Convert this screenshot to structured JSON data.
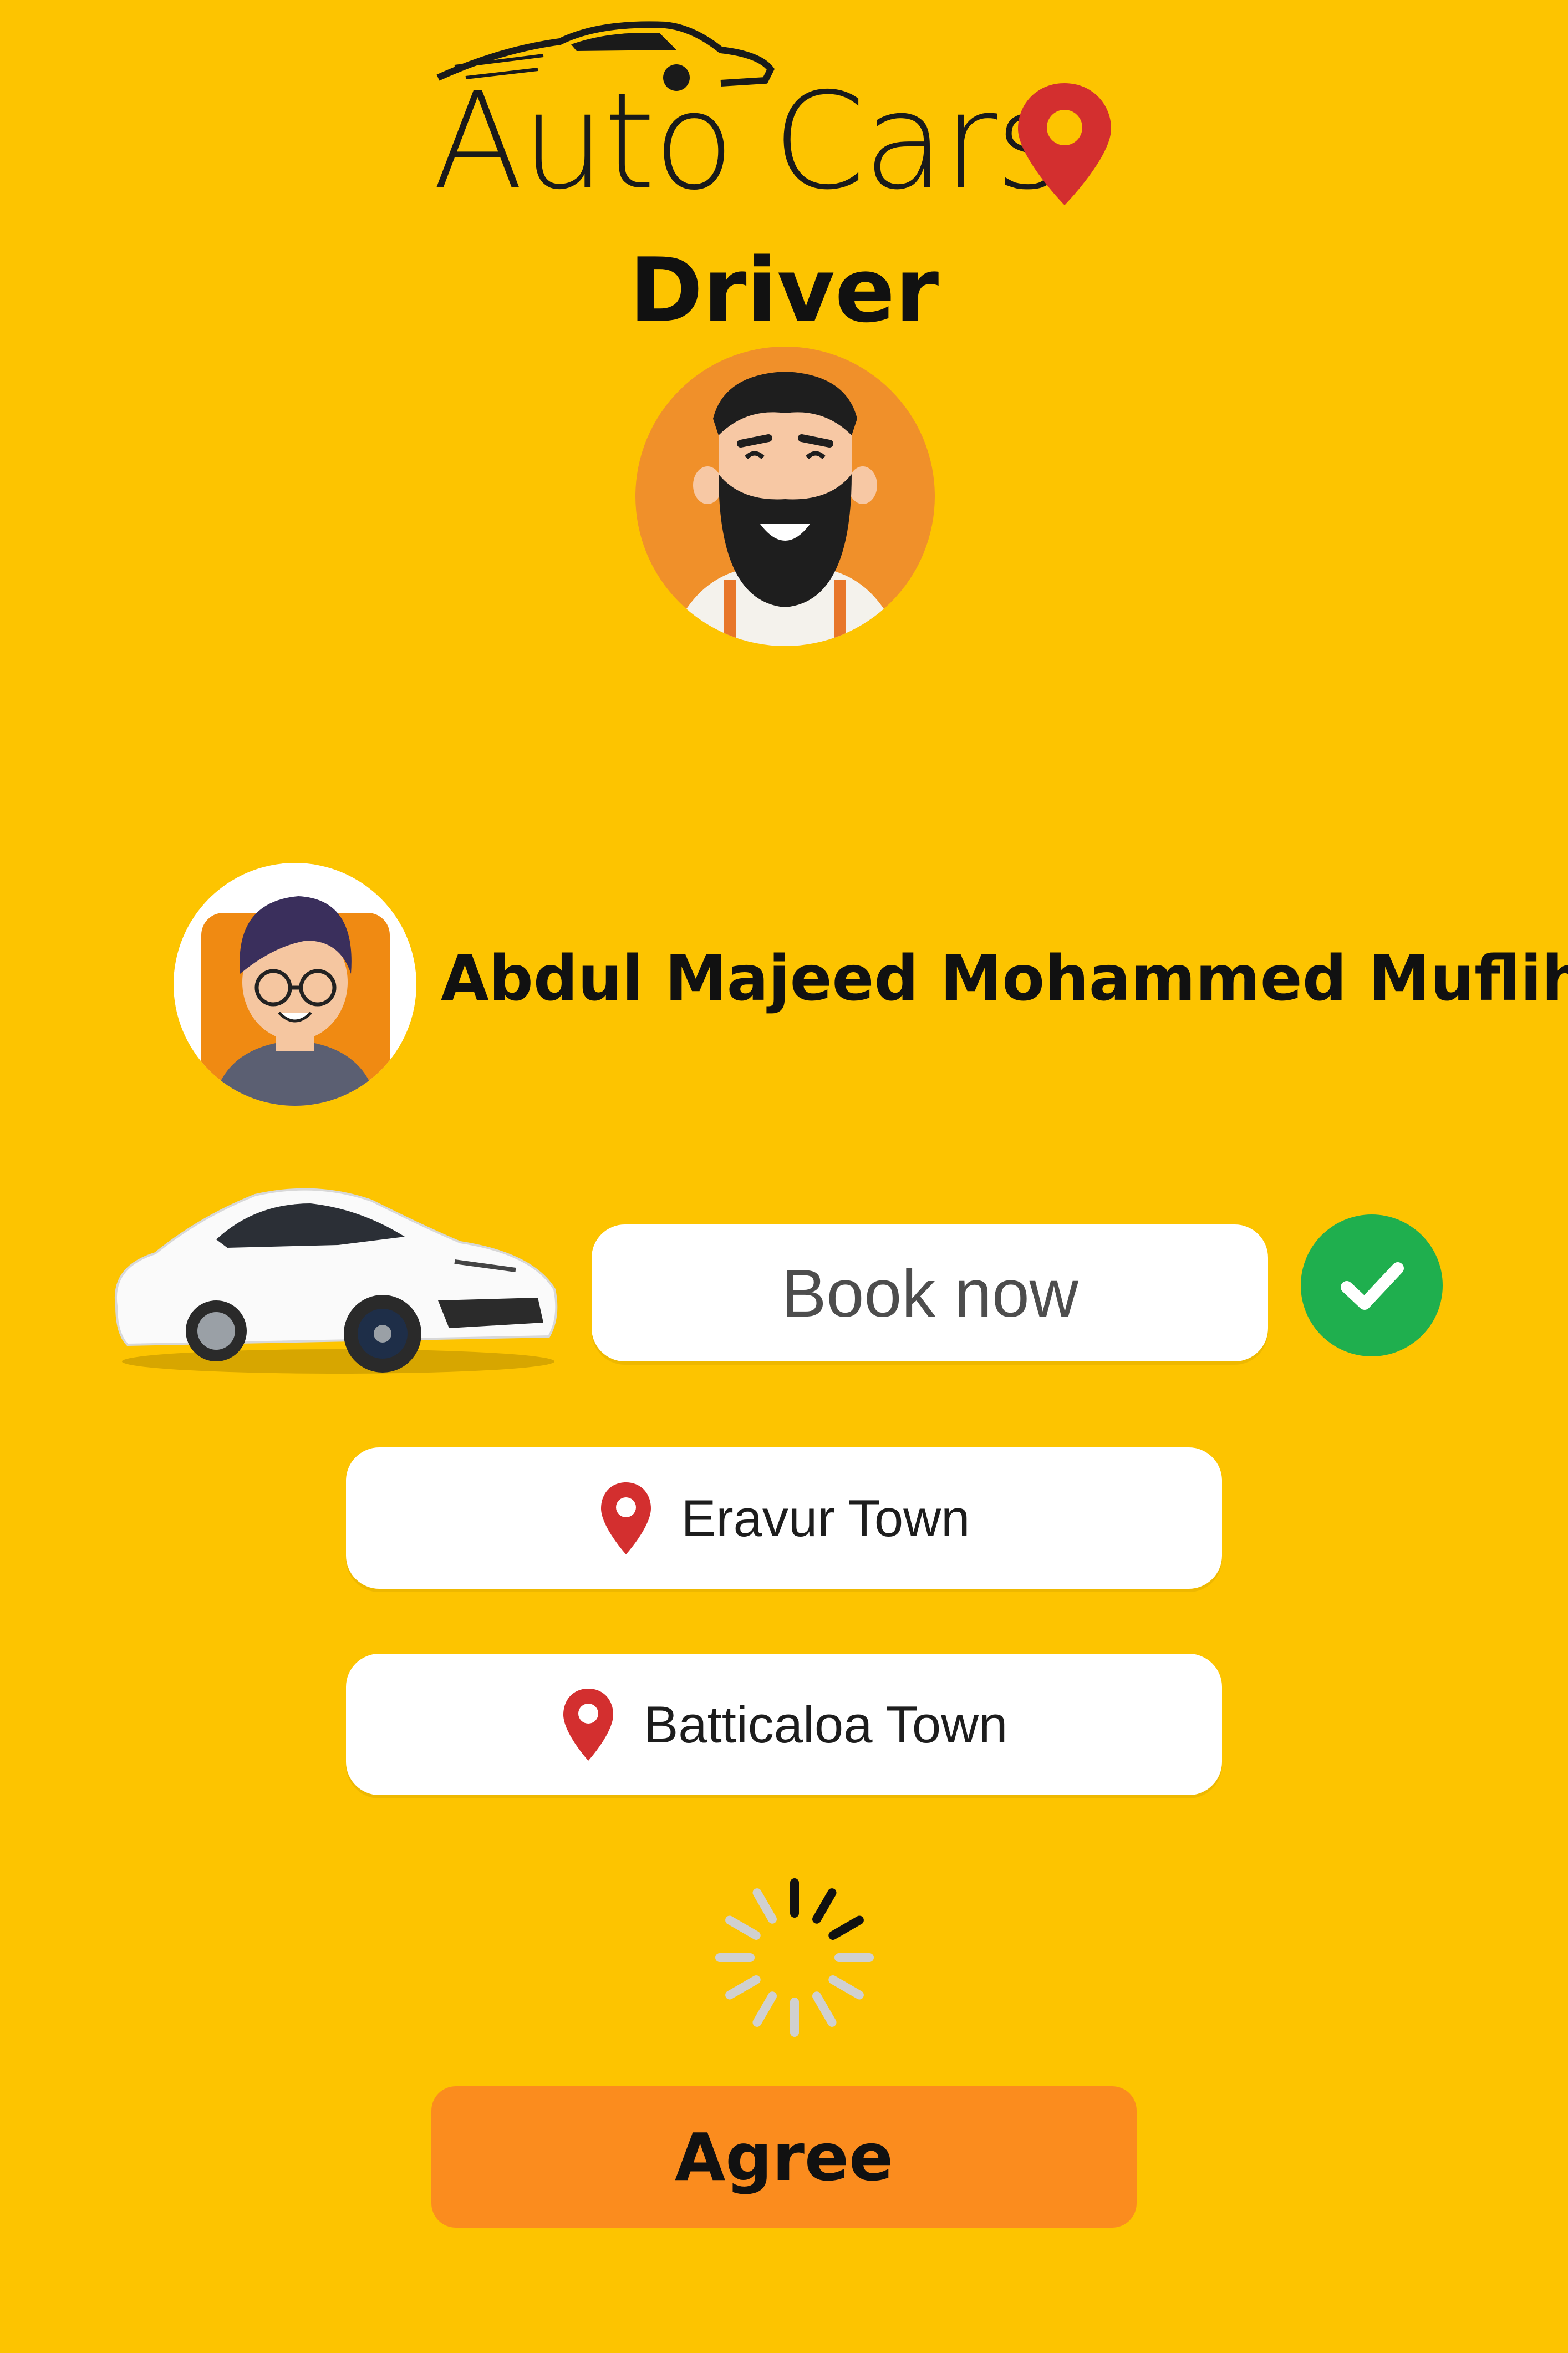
{
  "logo": {
    "text": "Auto Cars"
  },
  "page_title": "Driver",
  "passenger": {
    "name": "Abdul Majeed Mohammed Muflih"
  },
  "booking": {
    "book_label": "Book now"
  },
  "route": {
    "from": "Eravur Town",
    "to": "Batticaloa Town"
  },
  "actions": {
    "agree_label": "Agree"
  },
  "colors": {
    "background": "#FDC400",
    "agree_button": "#FB8C1E",
    "check": "#1FAF4E",
    "pin": "#D32F2F"
  },
  "icons": {
    "logo_pin": "location-pin-icon",
    "check": "check-icon",
    "location": "location-pin-icon",
    "spinner": "loading-spinner-icon"
  }
}
